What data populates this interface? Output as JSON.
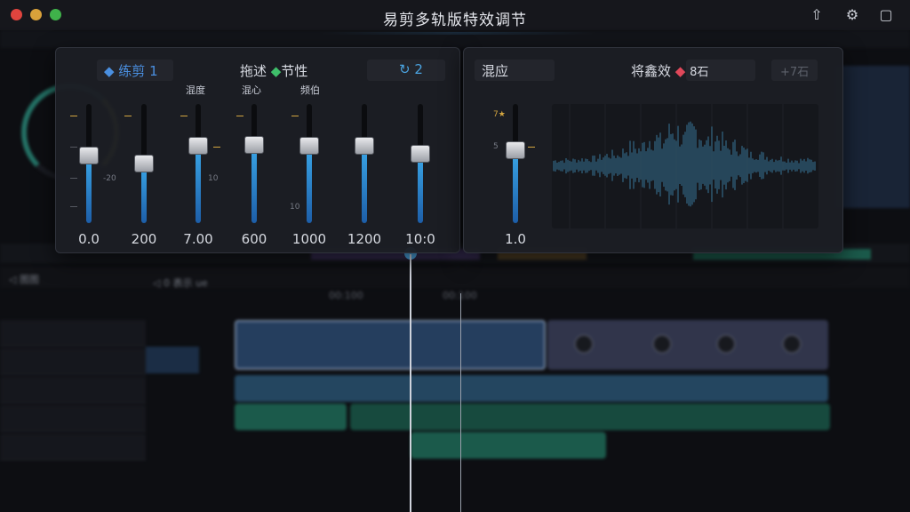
{
  "window": {
    "title": "易剪多轨版特效调节"
  },
  "toolbar": {
    "share_icon": "share-icon",
    "settings_icon": "gear-icon",
    "screen_icon": "screen-icon"
  },
  "mixer": {
    "header": {
      "clip_label": "◆ 练剪",
      "clip_num": "1",
      "mode_label": "拖述",
      "mode_marker": "◆",
      "mode_value": "节性",
      "channel_icon": "↻",
      "channel_value": "2"
    },
    "sublabels": [
      {
        "text": "混度",
        "color": "#4a90d8"
      },
      {
        "text": "混心",
        "color": "#4a90d8"
      },
      {
        "text": "频伯",
        "color": "#d4a640"
      }
    ],
    "faders": [
      {
        "value_label": "0.0",
        "level": 0.57
      },
      {
        "value_label": "200",
        "level": 0.5
      },
      {
        "value_label": "7.00",
        "level": 0.65
      },
      {
        "value_label": "600",
        "level": 0.66
      },
      {
        "value_label": "1000",
        "level": 0.65
      },
      {
        "value_label": "1200",
        "level": 0.65
      },
      {
        "value_label": "10:0",
        "level": 0.58
      }
    ],
    "marks": {
      "a": "-20",
      "b": "10",
      "c": "10"
    }
  },
  "reverb": {
    "title": "混应",
    "effect_label": "将鑫效",
    "effect_marker": "◆",
    "effect_value": "8石",
    "extra_value": "+7石",
    "fader": {
      "value_label": "1.0",
      "level": 0.61
    },
    "marks": {
      "top": "7★",
      "mid": "5"
    }
  },
  "timeline": {
    "ruler": [
      "00:100",
      "00:100"
    ],
    "track_label": "◁ 0 表示 ue",
    "left_label": "◁ 图图"
  },
  "colors": {
    "accent": "#3aa7e8",
    "warn": "#d4a640",
    "teal": "#1f6e5a"
  }
}
